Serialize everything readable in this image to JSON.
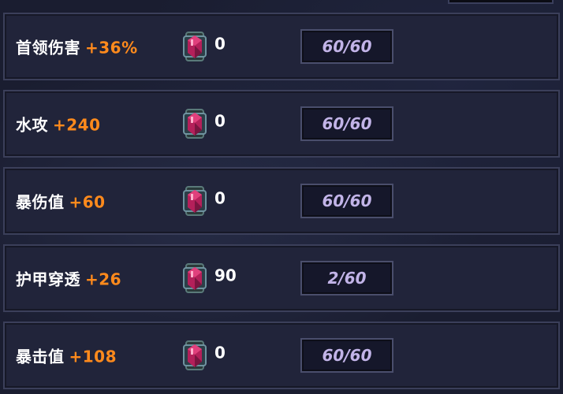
{
  "rows": [
    {
      "name": "首领伤害",
      "bonus": "+36%",
      "cost": "0",
      "progress": "60/60"
    },
    {
      "name": "水攻",
      "bonus": "+240",
      "cost": "0",
      "progress": "60/60"
    },
    {
      "name": "暴伤值",
      "bonus": "+60",
      "cost": "0",
      "progress": "60/60"
    },
    {
      "name": "护甲穿透",
      "bonus": "+26",
      "cost": "90",
      "progress": "2/60"
    },
    {
      "name": "暴击值",
      "bonus": "+108",
      "cost": "0",
      "progress": "60/60"
    }
  ],
  "colors": {
    "bonus": "#ff8a1c",
    "progress_text": "#c2b4e8",
    "panel": "#21243a"
  },
  "icons": {
    "cost": "red-crystal-gem-icon"
  }
}
